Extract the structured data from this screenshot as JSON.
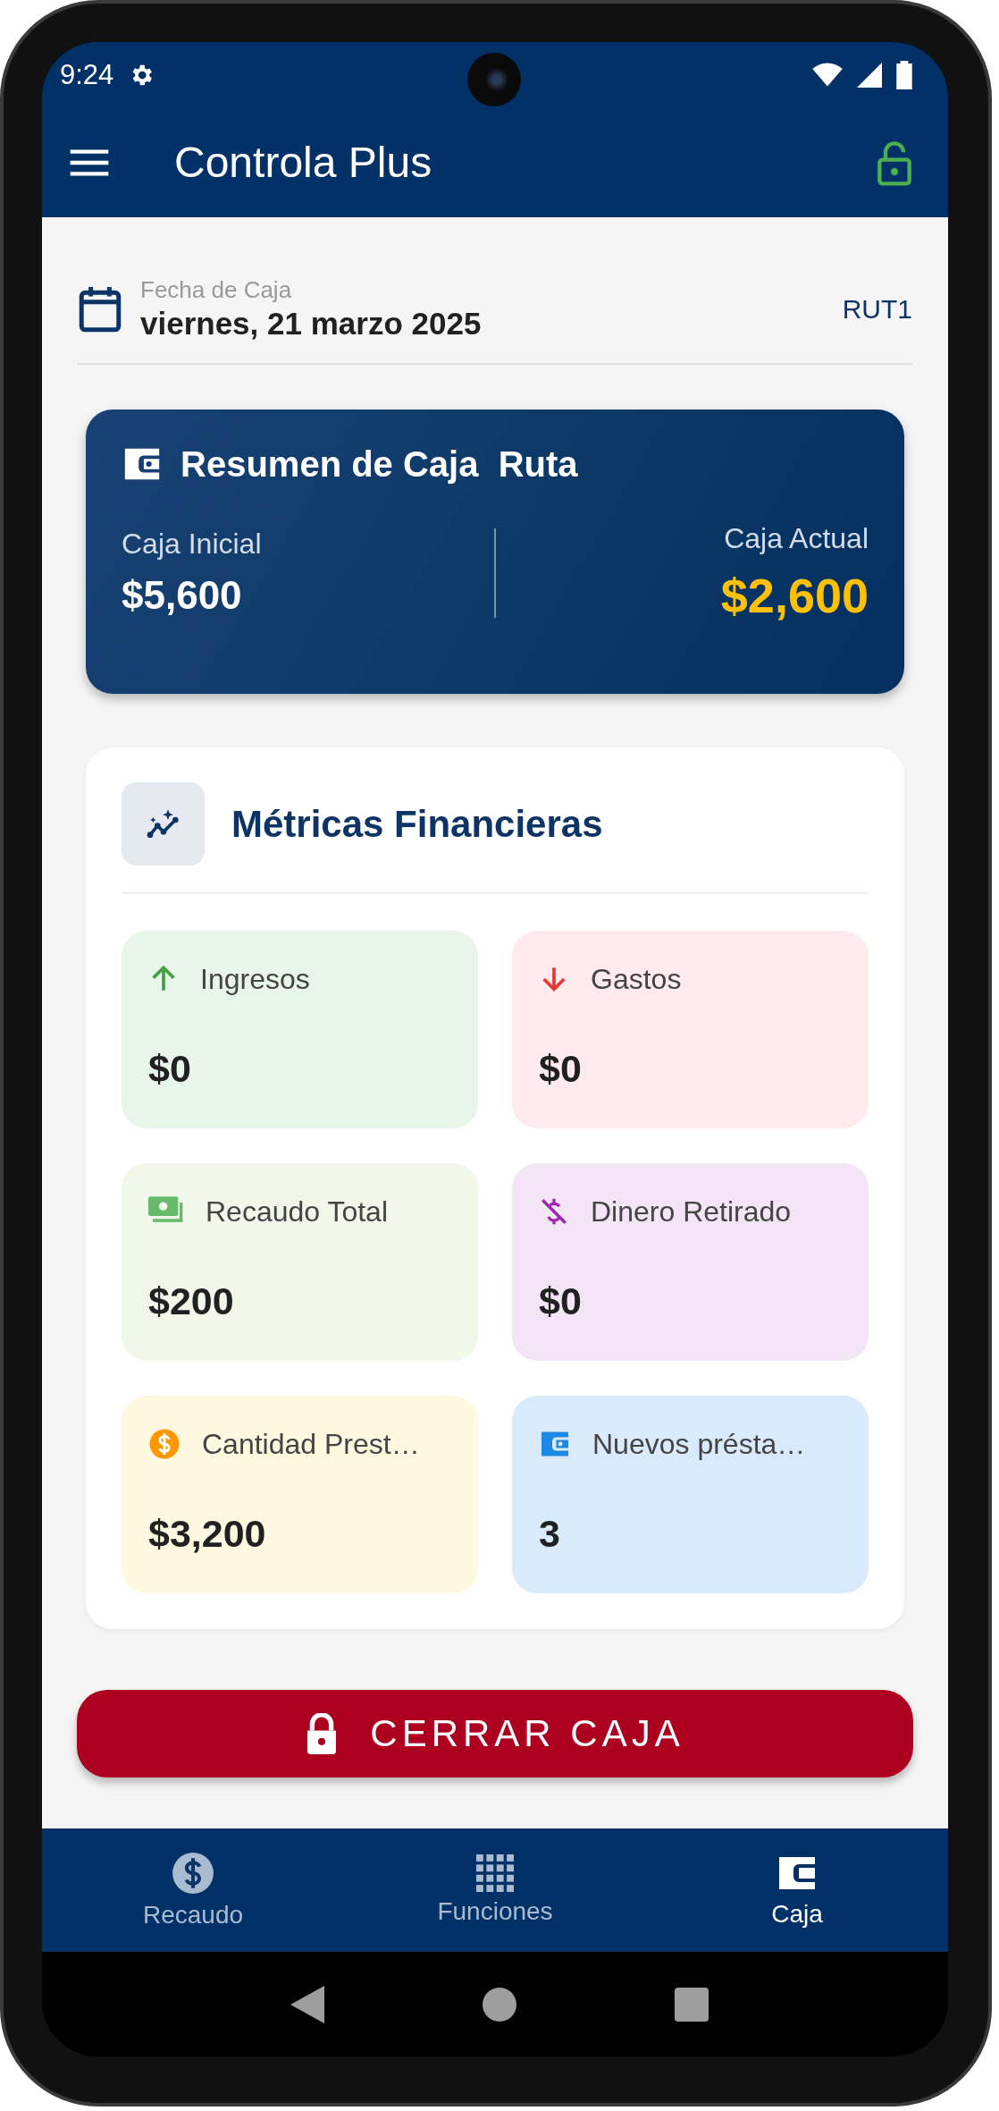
{
  "status_bar": {
    "time": "9:24"
  },
  "app_bar": {
    "title": "Controla Plus"
  },
  "date_header": {
    "label": "Fecha de Caja",
    "value": "viernes, 21 marzo 2025",
    "route": "RUT1"
  },
  "summary": {
    "title": "Resumen de Caja  Ruta",
    "initial_label": "Caja Inicial",
    "initial_value": "$5,600",
    "current_label": "Caja Actual",
    "current_value": "$2,600"
  },
  "metrics": {
    "title": "Métricas Financieras",
    "tiles": [
      {
        "kind": "income",
        "label": "Ingresos",
        "value": "$0",
        "color": "#e8f5e9"
      },
      {
        "kind": "expense",
        "label": "Gastos",
        "value": "$0",
        "color": "#ffebee"
      },
      {
        "kind": "collected",
        "label": "Recaudo Total",
        "value": "$200",
        "color": "#f1f8e9"
      },
      {
        "kind": "withdrawn",
        "label": "Dinero Retirado",
        "value": "$0",
        "color": "#f3e5f5"
      },
      {
        "kind": "lent",
        "label": "Cantidad Prest…",
        "value": "$3,200",
        "color": "#fff8e1"
      },
      {
        "kind": "loans",
        "label": "Nuevos présta…",
        "value": "3",
        "color": "#d8eafc"
      }
    ]
  },
  "close_button": {
    "label": "CERRAR CAJA"
  },
  "bottom_nav": [
    {
      "kind": "collect",
      "label": "Recaudo",
      "selected": false
    },
    {
      "kind": "functions",
      "label": "Funciones",
      "selected": false
    },
    {
      "kind": "cash",
      "label": "Caja",
      "selected": true
    }
  ]
}
